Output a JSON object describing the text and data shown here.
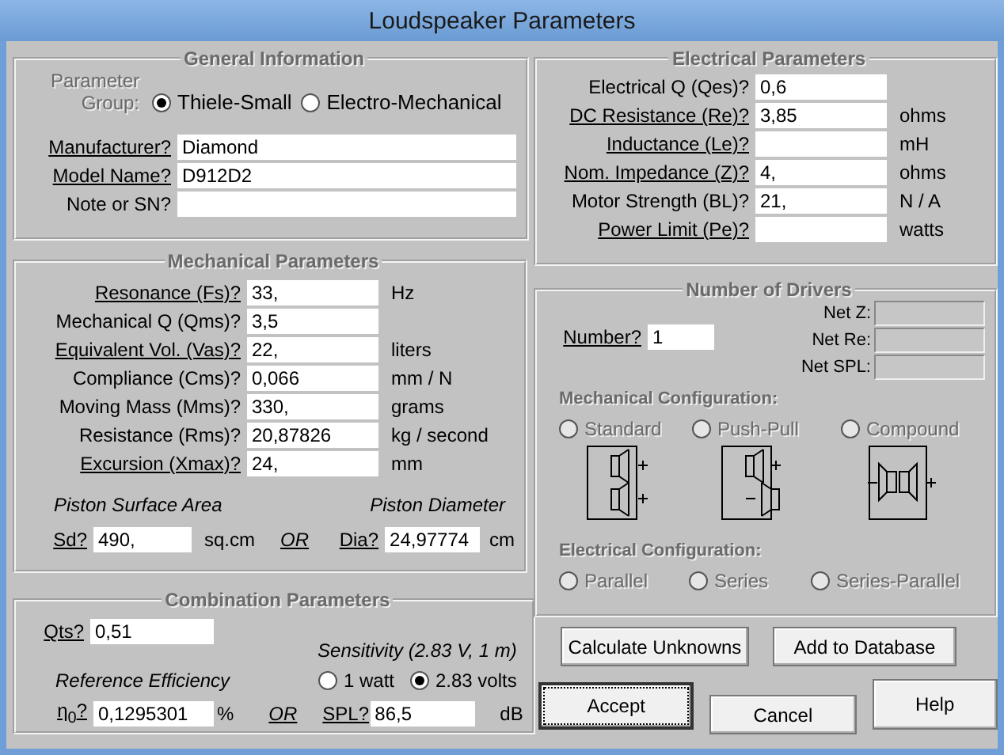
{
  "window": {
    "title": "Loudspeaker Parameters"
  },
  "general": {
    "title": "General Information",
    "group_label": "Parameter Group:",
    "group_options": [
      {
        "label": "Thiele-Small",
        "selected": true
      },
      {
        "label": "Electro-Mechanical",
        "selected": false
      }
    ],
    "fields": [
      {
        "label": "Manufacturer?",
        "link": true,
        "value": "Diamond"
      },
      {
        "label": "Model Name?",
        "link": true,
        "value": "D912D2"
      },
      {
        "label": "Note or SN?",
        "link": false
      }
    ]
  },
  "mechanical": {
    "title": "Mechanical Parameters",
    "fields": [
      {
        "label": "Resonance (Fs)?",
        "link": true,
        "value": "33,",
        "unit": "Hz"
      },
      {
        "label": "Mechanical Q (Qms)?",
        "link": false,
        "value": "3,5"
      },
      {
        "label": "Equivalent Vol. (Vas)?",
        "link": true,
        "value": "22,",
        "unit": "liters"
      },
      {
        "label": "Compliance (Cms)?",
        "link": false,
        "value": "0,066",
        "unit": "mm / N"
      },
      {
        "label": "Moving Mass (Mms)?",
        "link": false,
        "value": "330,",
        "unit": "grams"
      },
      {
        "label": "Resistance (Rms)?",
        "link": false,
        "value": "20,87826",
        "unit": "kg / second"
      },
      {
        "label": "Excursion (Xmax)?",
        "link": true,
        "value": "24,",
        "unit": "mm"
      }
    ],
    "area_heading": "Piston Surface Area",
    "diameter_heading": "Piston Diameter",
    "area": {
      "label": "Sd?",
      "link": true,
      "value": "490,",
      "unit": "sq.cm"
    },
    "or": "OR",
    "diameter": {
      "label": "Dia?",
      "link": true,
      "value": "24,97774",
      "unit": "cm"
    }
  },
  "combination": {
    "title": "Combination Parameters",
    "qts": {
      "label": "Qts?",
      "link": true,
      "value": "0,51"
    },
    "sensitivity_heading": "Sensitivity (2.83 V, 1 m)",
    "efficiency_heading": "Reference Efficiency",
    "sensitivity_options": [
      {
        "label": "1 watt",
        "selected": false
      },
      {
        "label": "2.83 volts",
        "selected": true
      }
    ],
    "efficiency": {
      "label": "η$_{0}$?",
      "link": true,
      "value": "0,1295301",
      "unit": "%"
    },
    "or": "OR",
    "spl": {
      "label": "SPL?",
      "link": true,
      "value": "86,5",
      "unit": "dB"
    }
  },
  "electrical": {
    "title": "Electrical Parameters",
    "fields": [
      {
        "label": "Electrical Q (Qes)?",
        "link": false,
        "value": "0,6"
      },
      {
        "label": "DC Resistance (Re)?",
        "link": true,
        "value": "3,85",
        "unit": "ohms"
      },
      {
        "label": "Inductance (Le)?",
        "link": true,
        "unit": "mH"
      },
      {
        "label": "Nom. Impedance (Z)?",
        "link": true,
        "value": "4,",
        "unit": "ohms"
      },
      {
        "label": "Motor Strength (BL)?",
        "link": false,
        "value": "21,",
        "unit": "N / A"
      },
      {
        "label": "Power Limit (Pe)?",
        "link": true,
        "unit": "watts"
      }
    ]
  },
  "drivers": {
    "title": "Number of Drivers",
    "number": {
      "label": "Number?",
      "link": true,
      "value": "1"
    },
    "net_fields": [
      {
        "label": "Net Z:"
      },
      {
        "label": "Net Re:"
      },
      {
        "label": "Net SPL:"
      }
    ],
    "mechanical_configuration": {
      "label": "Mechanical Configuration:",
      "disabled": true,
      "options": [
        {
          "label": "Standard",
          "selected": false,
          "kind": "standard"
        },
        {
          "label": "Push-Pull",
          "selected": false,
          "kind": "push-pull"
        },
        {
          "label": "Compound",
          "selected": false,
          "kind": "compound"
        }
      ]
    },
    "electrical_configuration": {
      "label": "Electrical Configuration:",
      "disabled": true,
      "options": [
        {
          "label": "Parallel",
          "selected": false
        },
        {
          "label": "Series",
          "selected": false
        },
        {
          "label": "Series-Parallel",
          "selected": false
        }
      ]
    }
  },
  "buttons": [
    {
      "label": "Calculate Unknowns",
      "focused": false
    },
    {
      "label": "Add to Database",
      "focused": false
    }
  ],
  "dialog_buttons": [
    {
      "label": "Accept",
      "focused": true
    },
    {
      "label": "Cancel",
      "focused": false
    },
    {
      "label": "Help",
      "focused": false
    }
  ]
}
